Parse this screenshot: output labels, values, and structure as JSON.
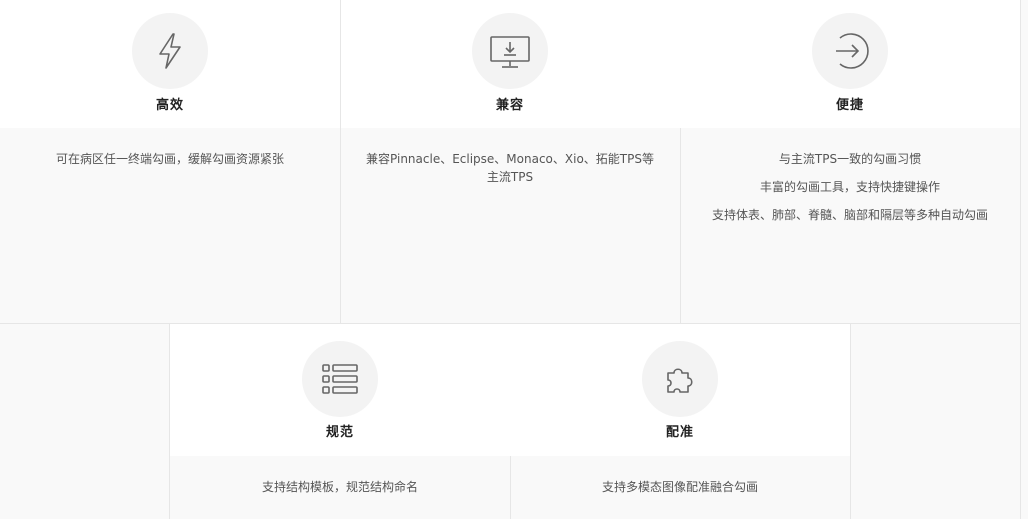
{
  "features": [
    {
      "icon": "lightning-icon",
      "title": "高效",
      "lines": [
        "可在病区任一终端勾画，缓解勾画资源紧张"
      ]
    },
    {
      "icon": "monitor-download-icon",
      "title": "兼容",
      "lines": [
        "兼容Pinnacle、Eclipse、Monaco、Xio、拓能TPS等主流TPS"
      ]
    },
    {
      "icon": "sign-in-arrow-icon",
      "title": "便捷",
      "lines": [
        "与主流TPS一致的勾画习惯",
        "丰富的勾画工具，支持快捷键操作",
        "支持体表、肺部、脊髓、脑部和隔层等多种自动勾画"
      ]
    },
    {
      "icon": "list-icon",
      "title": "规范",
      "lines": [
        "支持结构模板，规范结构命名"
      ]
    },
    {
      "icon": "puzzle-icon",
      "title": "配准",
      "lines": [
        "支持多模态图像配准融合勾画"
      ]
    }
  ]
}
